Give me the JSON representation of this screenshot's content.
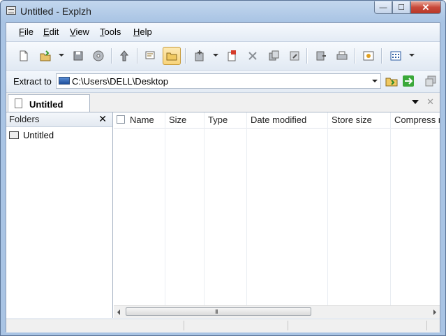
{
  "window": {
    "title": "Untitled - Explzh",
    "caption": {
      "minimize": "—",
      "maximize": "☐",
      "close": "✕"
    }
  },
  "menubar": {
    "items": [
      {
        "label": "File",
        "mnemonic": "F",
        "rest": "ile"
      },
      {
        "label": "Edit",
        "mnemonic": "E",
        "rest": "dit"
      },
      {
        "label": "View",
        "mnemonic": "V",
        "rest": "iew"
      },
      {
        "label": "Tools",
        "mnemonic": "T",
        "rest": "ools"
      },
      {
        "label": "Help",
        "mnemonic": "H",
        "rest": "elp"
      }
    ]
  },
  "toolbar": {
    "icons": [
      "new-archive-icon",
      "open-archive-icon",
      "save-icon",
      "burn-icon",
      "extract-icon",
      "view-icon",
      "folder-view-icon",
      "add-icon",
      "split-icon",
      "delete-icon",
      "copy-icon",
      "attach-icon",
      "print-icon",
      "print-setup-icon",
      "sfx-icon",
      "list-view-icon"
    ],
    "active": "folder-view-icon"
  },
  "extract": {
    "label": "Extract to",
    "mnemonic": "x",
    "path": "C:\\Users\\DELL\\Desktop"
  },
  "tabs": [
    {
      "label": "Untitled"
    }
  ],
  "tab_controls": {
    "close": "✕"
  },
  "folders": {
    "title": "Folders",
    "close": "✕",
    "items": [
      {
        "label": "Untitled"
      }
    ]
  },
  "filelist": {
    "columns": [
      "Name",
      "Size",
      "Type",
      "Date modified",
      "Store size",
      "Compress ratio"
    ]
  },
  "scrollbar": {
    "grip": "III"
  }
}
